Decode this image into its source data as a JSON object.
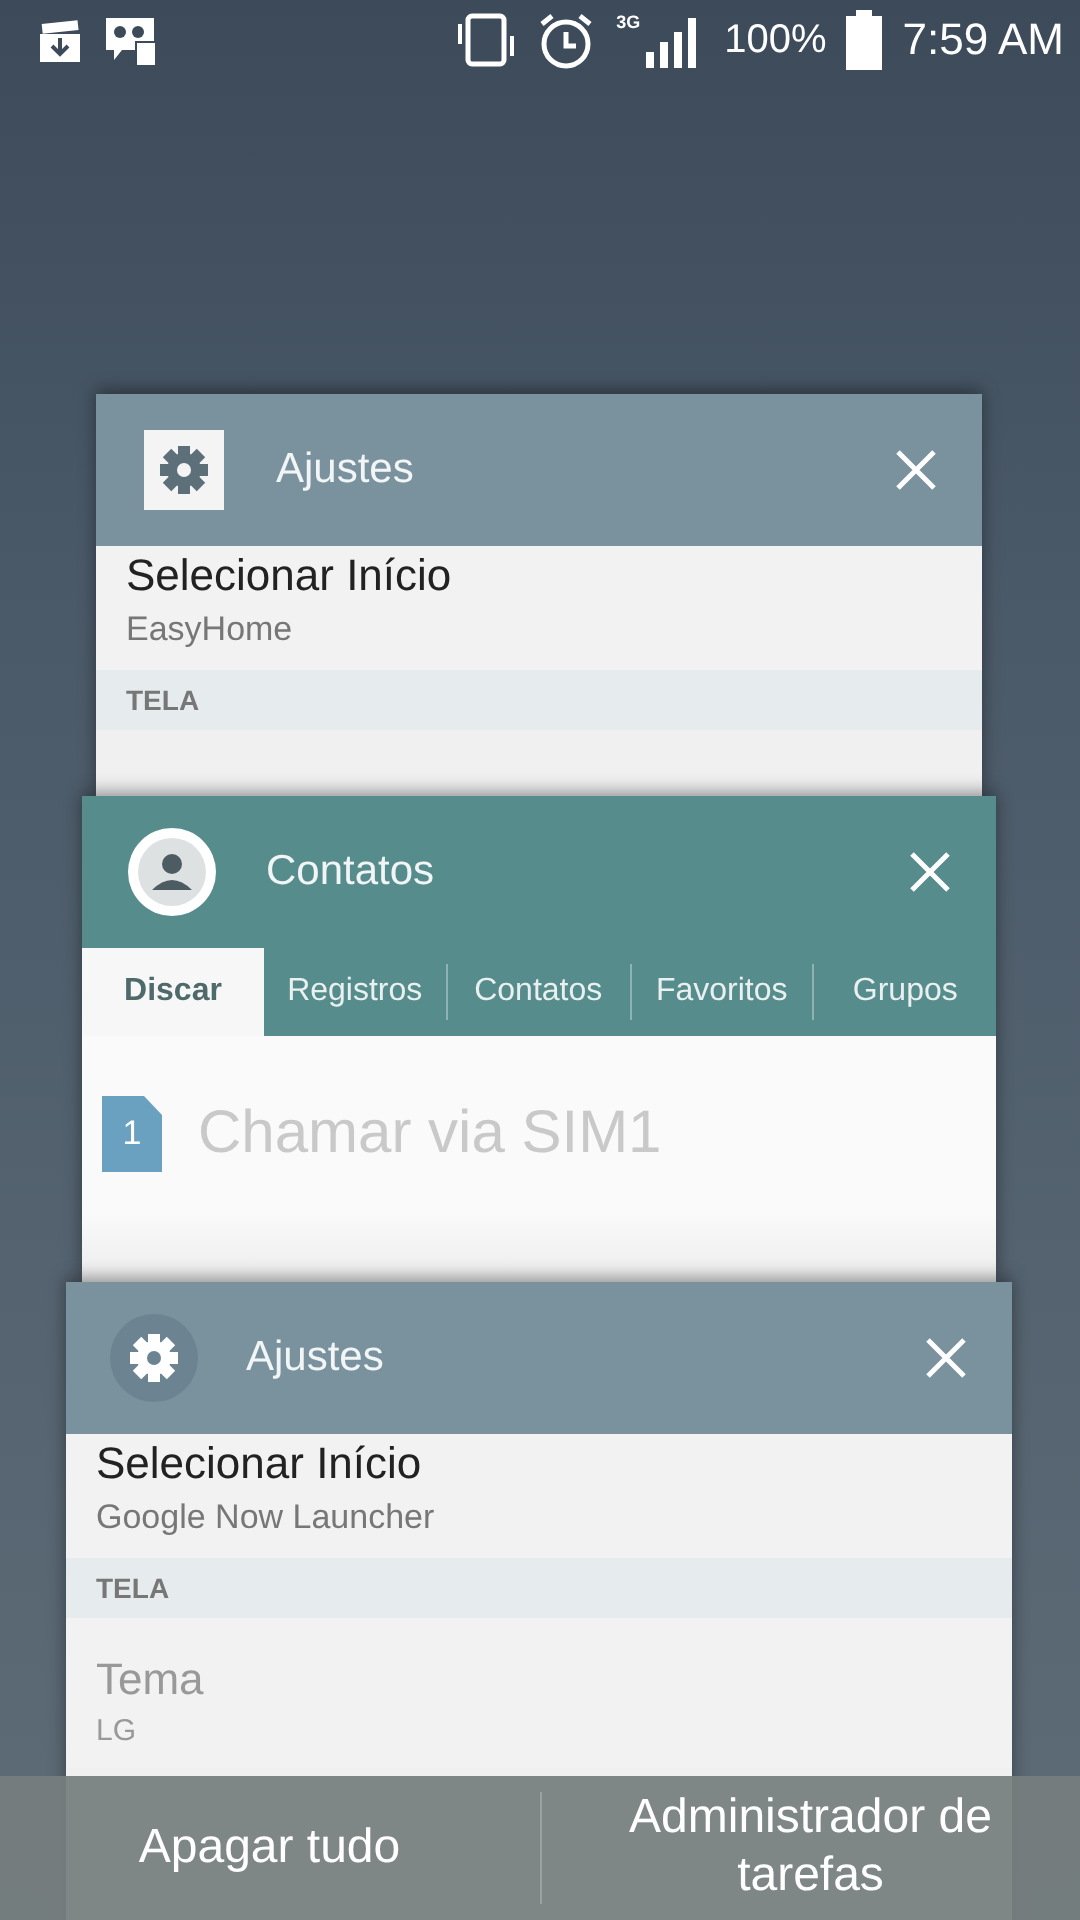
{
  "status_bar": {
    "network": "3G",
    "battery": "100%",
    "time": "7:59 AM"
  },
  "cards": [
    {
      "kind": "settings",
      "title": "Ajustes",
      "rows": [
        {
          "kind": "item",
          "title": "Selecionar Início",
          "value": "EasyHome"
        },
        {
          "kind": "section",
          "title": "TELA"
        }
      ]
    },
    {
      "kind": "contacts",
      "title": "Contatos",
      "tabs": [
        {
          "label": "Discar",
          "selected": true
        },
        {
          "label": "Registros",
          "selected": false
        },
        {
          "label": "Contatos",
          "selected": false
        },
        {
          "label": "Favoritos",
          "selected": false
        },
        {
          "label": "Grupos",
          "selected": false
        }
      ],
      "sim_badge": "1",
      "action": "Chamar via SIM1"
    },
    {
      "kind": "settings",
      "title": "Ajustes",
      "rows": [
        {
          "kind": "item",
          "title": "Selecionar Início",
          "value": "Google Now Launcher"
        },
        {
          "kind": "section",
          "title": "TELA"
        },
        {
          "kind": "faded",
          "title": "Tema",
          "value": "LG"
        }
      ]
    }
  ],
  "bottom_bar": [
    "Apagar tudo",
    "Administrador de tarefas"
  ]
}
